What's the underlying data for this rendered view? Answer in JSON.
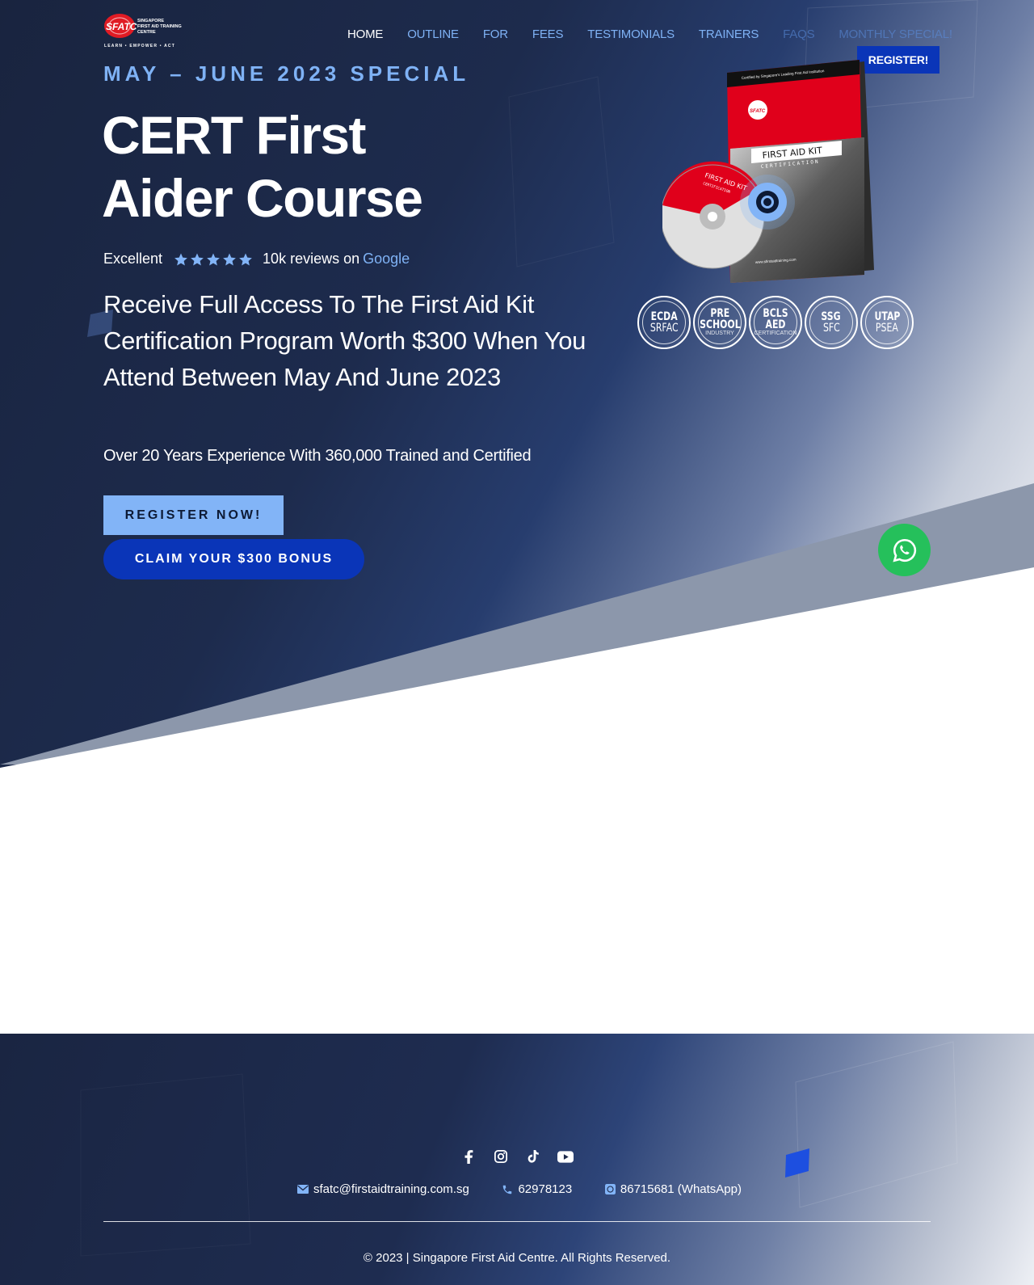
{
  "header": {
    "logo_text": "SFATC",
    "logo_lines": [
      "SINGAPORE",
      "FIRST AID TRAINING",
      "CENTRE"
    ],
    "logo_tagline": "LEARN • EMPOWER • ACT",
    "nav": [
      "HOME",
      "OUTLINE",
      "FOR",
      "FEES",
      "TESTIMONIALS",
      "TRAINERS",
      "FAQS",
      "MONTHLY SPECIAL!"
    ],
    "register_label": "REGISTER!"
  },
  "hero": {
    "kicker": "MAY – JUNE 2023 SPECIAL",
    "title_line1": "CERT First",
    "title_line2": "Aider Course",
    "rating_label": "Excellent",
    "rating_stars": 5,
    "reviews_text": "10k reviews on",
    "reviews_source": "Google",
    "subhead": "Receive Full Access To The First Aid Kit Certification Program Worth $300 When You Attend Between May And June 2023",
    "experience": "Over 20 Years Experience With 360,000 Trained and Certified",
    "register_button": "REGISTER NOW!",
    "claim_button": "CLAIM YOUR $300 BONUS"
  },
  "product": {
    "box_title": "FIRST AID KIT",
    "box_subtitle": "CERTIFICATION",
    "disc_title": "FIRST AID KIT",
    "disc_subtitle": "CERTIFICATION",
    "box_top_text": "Certified by Singapore's Leading First Aid Institution",
    "box_url": "www.sfirstaidtraining.com"
  },
  "badges": [
    {
      "l1": "ECDA",
      "l2": "SRFAC",
      "l3": ""
    },
    {
      "l1": "PRE",
      "l2": "SCHOOL",
      "l3": "INDUSTRY"
    },
    {
      "l1": "BCLS",
      "l2": "AED",
      "l3": "CERTIFICATION"
    },
    {
      "l1": "SSG",
      "l2": "SFC",
      "l3": ""
    },
    {
      "l1": "UTAP",
      "l2": "PSEA",
      "l3": ""
    }
  ],
  "footer": {
    "social_icons": [
      "facebook-icon",
      "instagram-icon",
      "tiktok-icon",
      "youtube-icon"
    ],
    "email": "sfatc@firstaidtraining.com.sg",
    "phone": "62978123",
    "whatsapp": "86715681 (WhatsApp)",
    "copyright": "© 2023 | Singapore First Aid Centre. All Rights Reserved."
  },
  "colors": {
    "accent_light_blue": "#82b4f7",
    "brand_blue": "#0a35b8",
    "navy": "#1b2746",
    "whatsapp_green": "#25c05b"
  }
}
